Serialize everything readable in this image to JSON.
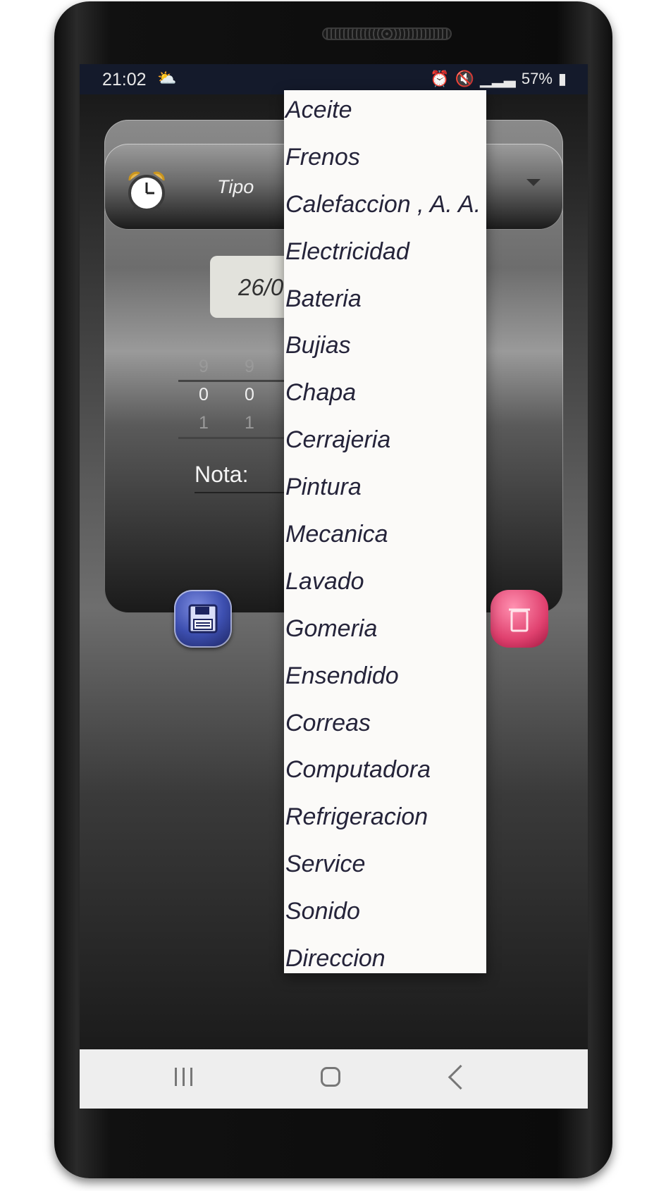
{
  "status": {
    "time": "21:02",
    "battery": "57%"
  },
  "form": {
    "tipo_label": "Tipo",
    "date_value": "26/0",
    "picker": {
      "col1": {
        "above": "9",
        "selected": "0",
        "below": "1"
      },
      "col2": {
        "above": "9",
        "selected": "0",
        "below": "1"
      }
    },
    "nota_label": "Nota:"
  },
  "dropdown": {
    "items": [
      "Aceite",
      "Frenos",
      "Calefaccion , A. A.",
      "Electricidad",
      "Bateria",
      "Bujias",
      "Chapa",
      "Cerrajeria",
      "Pintura",
      "Mecanica",
      "Lavado",
      "Gomeria",
      "Ensendido",
      "Correas",
      "Computadora",
      "Refrigeracion",
      "Service",
      "Sonido",
      "Direccion"
    ]
  },
  "colors": {
    "dropdown_text": "#25243a",
    "save_button": "#3d4fb0",
    "delete_button": "#e0416f",
    "status_bar": "#141a2b"
  },
  "icons": {
    "tipo": "alarm-clock-icon",
    "save": "floppy-disk-icon",
    "delete": "trash-icon"
  }
}
